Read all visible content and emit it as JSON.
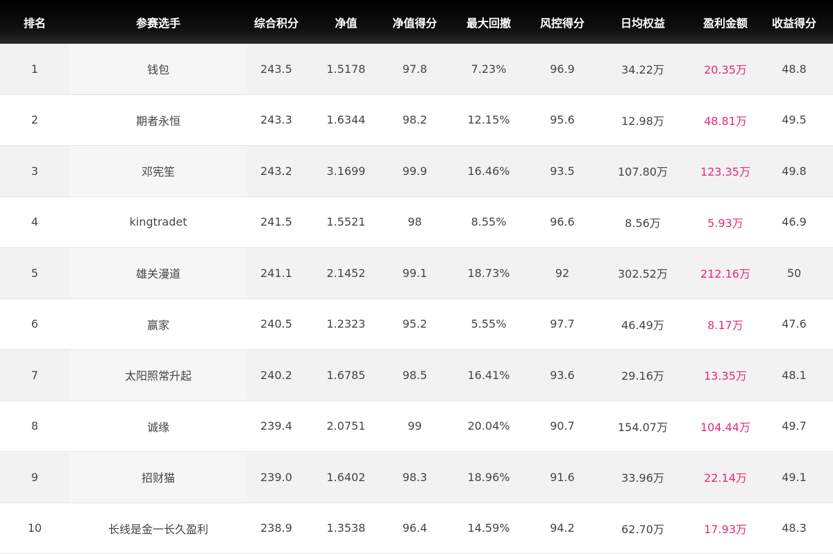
{
  "table": {
    "columns": [
      "排名",
      "参赛选手",
      "综合积分",
      "净值",
      "净值得分",
      "最大回撤",
      "风控得分",
      "日均权益",
      "盈利金额",
      "收益得分"
    ],
    "rows": [
      [
        "1",
        "钱包",
        "243.5",
        "1.5178",
        "97.8",
        "7.23%",
        "96.9",
        "34.22万",
        "20.35万",
        "48.8"
      ],
      [
        "2",
        "期者永恒",
        "243.3",
        "1.6344",
        "98.2",
        "12.15%",
        "95.6",
        "12.98万",
        "48.81万",
        "49.5"
      ],
      [
        "3",
        "邓宪笙",
        "243.2",
        "3.1699",
        "99.9",
        "16.46%",
        "93.5",
        "107.80万",
        "123.35万",
        "49.8"
      ],
      [
        "4",
        "kingtradet",
        "241.5",
        "1.5521",
        "98",
        "8.55%",
        "96.6",
        "8.56万",
        "5.93万",
        "46.9"
      ],
      [
        "5",
        "雄关漫道",
        "241.1",
        "2.1452",
        "99.1",
        "18.73%",
        "92",
        "302.52万",
        "212.16万",
        "50"
      ],
      [
        "6",
        "赢家",
        "240.5",
        "1.2323",
        "95.2",
        "5.55%",
        "97.7",
        "46.49万",
        "8.17万",
        "47.6"
      ],
      [
        "7",
        "太阳照常升起",
        "240.2",
        "1.6785",
        "98.5",
        "16.41%",
        "93.6",
        "29.16万",
        "13.35万",
        "48.1"
      ],
      [
        "8",
        "诚缘",
        "239.4",
        "2.0751",
        "99",
        "20.04%",
        "90.7",
        "154.07万",
        "104.44万",
        "49.7"
      ],
      [
        "9",
        "招财猫",
        "239.0",
        "1.6402",
        "98.3",
        "18.96%",
        "91.6",
        "33.96万",
        "22.14万",
        "49.1"
      ],
      [
        "10",
        "长线是金一长久盈利",
        "238.9",
        "1.3538",
        "96.4",
        "14.59%",
        "94.2",
        "62.70万",
        "17.93万",
        "48.3"
      ]
    ]
  },
  "colors": {
    "header_bg": "#000000",
    "header_text": "#ffffff",
    "row_alt_bg": "#f2f2f2",
    "body_text": "#444444",
    "profit_text": "#e6277a"
  }
}
